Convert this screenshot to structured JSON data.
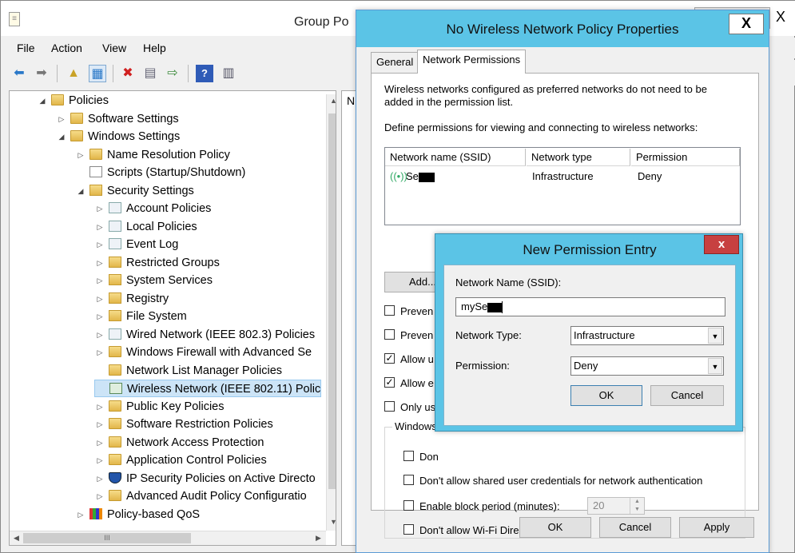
{
  "main_window": {
    "title": "Group Po",
    "close_glyph": "X",
    "menu": [
      "File",
      "Action",
      "View",
      "Help"
    ],
    "toolbar_icons": [
      "back-arrow-icon",
      "forward-arrow-icon",
      "up-folder-icon",
      "show-hide-tree-icon",
      "delete-icon",
      "properties-icon",
      "export-list-icon",
      "help-icon",
      "show-pane-icon"
    ],
    "tree": [
      {
        "label": "Policies",
        "indent": 0,
        "toggle": "◢",
        "icon": "folder"
      },
      {
        "label": "Software Settings",
        "indent": 1,
        "toggle": "▷",
        "icon": "folder"
      },
      {
        "label": "Windows Settings",
        "indent": 1,
        "toggle": "◢",
        "icon": "folder"
      },
      {
        "label": "Name Resolution Policy",
        "indent": 2,
        "toggle": "▷",
        "icon": "folder"
      },
      {
        "label": "Scripts (Startup/Shutdown)",
        "indent": 2,
        "toggle": "",
        "icon": "script"
      },
      {
        "label": "Security Settings",
        "indent": 2,
        "toggle": "◢",
        "icon": "folder-lock"
      },
      {
        "label": "Account Policies",
        "indent": 3,
        "toggle": "▷",
        "icon": "doc"
      },
      {
        "label": "Local Policies",
        "indent": 3,
        "toggle": "▷",
        "icon": "doc"
      },
      {
        "label": "Event Log",
        "indent": 3,
        "toggle": "▷",
        "icon": "doc"
      },
      {
        "label": "Restricted Groups",
        "indent": 3,
        "toggle": "▷",
        "icon": "folder-lock"
      },
      {
        "label": "System Services",
        "indent": 3,
        "toggle": "▷",
        "icon": "folder-lock"
      },
      {
        "label": "Registry",
        "indent": 3,
        "toggle": "▷",
        "icon": "folder-lock"
      },
      {
        "label": "File System",
        "indent": 3,
        "toggle": "▷",
        "icon": "folder-lock"
      },
      {
        "label": "Wired Network (IEEE 802.3) Policies",
        "indent": 3,
        "toggle": "▷",
        "icon": "doc"
      },
      {
        "label": "Windows Firewall with Advanced Se",
        "indent": 3,
        "toggle": "▷",
        "icon": "folder"
      },
      {
        "label": "Network List Manager Policies",
        "indent": 3,
        "toggle": "",
        "icon": "folder"
      },
      {
        "label": "Wireless Network (IEEE 802.11) Polic",
        "indent": 3,
        "toggle": "",
        "icon": "wifi",
        "selected": true
      },
      {
        "label": "Public Key Policies",
        "indent": 3,
        "toggle": "▷",
        "icon": "folder"
      },
      {
        "label": "Software Restriction Policies",
        "indent": 3,
        "toggle": "▷",
        "icon": "folder"
      },
      {
        "label": "Network Access Protection",
        "indent": 3,
        "toggle": "▷",
        "icon": "folder"
      },
      {
        "label": "Application Control Policies",
        "indent": 3,
        "toggle": "▷",
        "icon": "folder"
      },
      {
        "label": "IP Security Policies on Active Directo",
        "indent": 3,
        "toggle": "▷",
        "icon": "shield"
      },
      {
        "label": "Advanced Audit Policy Configuratio",
        "indent": 3,
        "toggle": "▷",
        "icon": "folder"
      },
      {
        "label": "Policy-based QoS",
        "indent": 2,
        "toggle": "▷",
        "icon": "chart"
      }
    ],
    "right_pane_header": "N",
    "hscroll_grip": "III"
  },
  "properties_dialog": {
    "title": "No Wireless Network Policy Properties",
    "close_glyph": "X",
    "tabs": [
      "General",
      "Network Permissions"
    ],
    "intro": "Wireless networks configured as preferred networks do not need to be added in the permission list.",
    "define_label": "Define permissions for viewing and connecting to wireless networks:",
    "columns": [
      "Network name (SSID)",
      "Network type",
      "Permission"
    ],
    "rows": [
      {
        "ssid": "Se",
        "type": "Infrastructure",
        "permission": "Deny"
      }
    ],
    "add_button": "Add...",
    "checkboxes": [
      {
        "label": "Preven",
        "checked": false
      },
      {
        "label": "Preven",
        "checked": false
      },
      {
        "label": "Allow u",
        "checked": true
      },
      {
        "label": "Allow e",
        "checked": true
      },
      {
        "label": "Only us",
        "checked": false
      }
    ],
    "group_legend": "Windows",
    "group_checkboxes": [
      {
        "label": "Don",
        "checked": false
      },
      {
        "label": "Don't allow shared user credentials for network authentication",
        "checked": false
      },
      {
        "label": "Enable block period (minutes):",
        "checked": false
      },
      {
        "label": "Don't allow Wi-Fi Direct groups",
        "checked": false
      }
    ],
    "block_period_value": "20",
    "ok": "OK",
    "cancel": "Cancel",
    "apply": "Apply"
  },
  "new_permission_entry": {
    "title": "New Permission Entry",
    "close_glyph": "x",
    "ssid_label": "Network Name (SSID):",
    "ssid_value": "mySe",
    "type_label": "Network Type:",
    "type_value": "Infrastructure",
    "permission_label": "Permission:",
    "permission_value": "Deny",
    "ok": "OK",
    "cancel": "Cancel"
  }
}
